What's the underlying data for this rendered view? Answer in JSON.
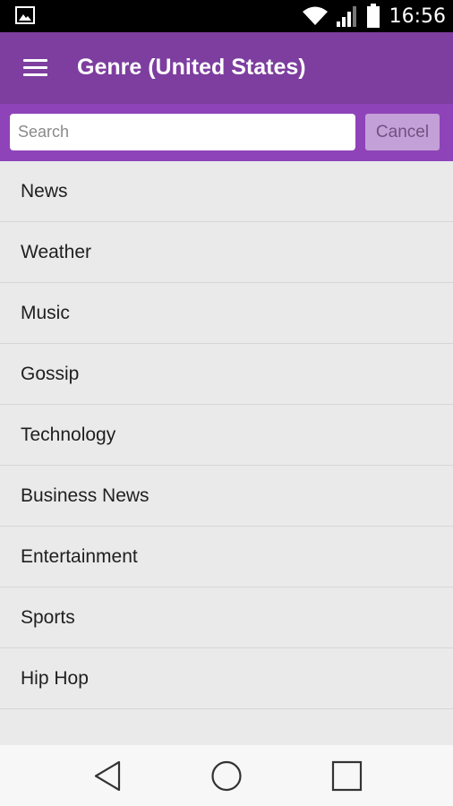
{
  "status_bar": {
    "time": "16:56",
    "icons": [
      "image-icon",
      "wifi-icon",
      "signal-icon",
      "battery-icon"
    ]
  },
  "app_bar": {
    "title": "Genre (United States)",
    "menu_icon": "hamburger-menu-icon",
    "background_color": "#7d3e9f"
  },
  "search": {
    "placeholder": "Search",
    "value": "",
    "cancel_label": "Cancel",
    "background_color": "#8e44b8"
  },
  "genres": [
    {
      "label": "News"
    },
    {
      "label": "Weather"
    },
    {
      "label": "Music"
    },
    {
      "label": "Gossip"
    },
    {
      "label": "Technology"
    },
    {
      "label": "Business News"
    },
    {
      "label": "Entertainment"
    },
    {
      "label": "Sports"
    },
    {
      "label": "Hip Hop"
    },
    {
      "label": ""
    }
  ],
  "nav_bar": {
    "buttons": [
      "back-icon",
      "home-icon",
      "recents-icon"
    ]
  }
}
